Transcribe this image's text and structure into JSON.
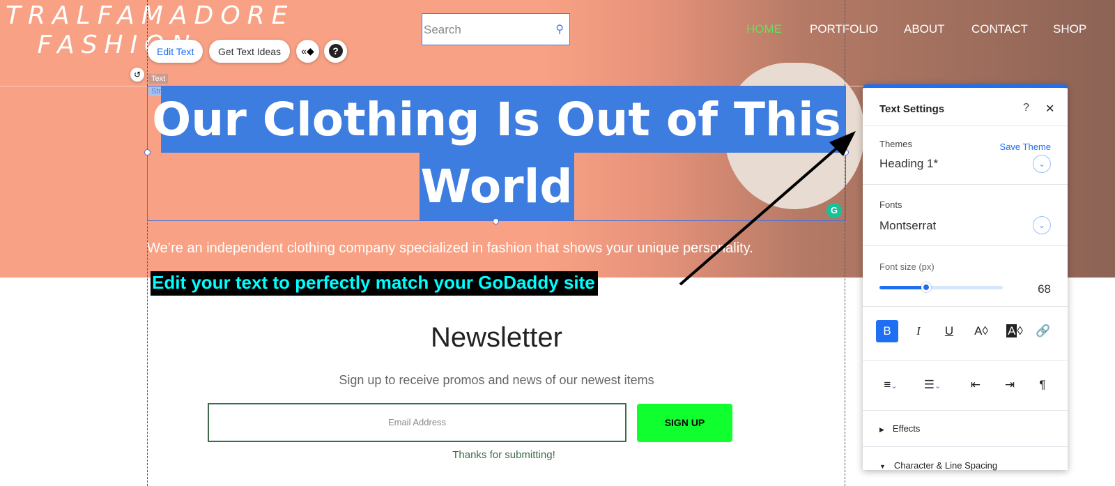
{
  "site": {
    "logo_line1": "TRALFAMADORE",
    "logo_line2": "FASHION",
    "search_placeholder": "Search",
    "nav": [
      {
        "label": "HOME",
        "color": "#66e05a"
      },
      {
        "label": "PORTFOLIO"
      },
      {
        "label": "ABOUT"
      },
      {
        "label": "CONTACT"
      },
      {
        "label": "SHOP"
      }
    ],
    "heading_line1": "Our Clothing Is Out of This",
    "heading_line2": "World",
    "subtitle": "We’re an independent clothing company specialized in fashion that shows your unique personality.",
    "newsletter": {
      "title": "Newsletter",
      "subtitle": "Sign up to receive promos and news of our newest items",
      "email_placeholder": "Email Address",
      "button": "SIGN UP",
      "thanks": "Thanks for submitting!"
    }
  },
  "editor": {
    "edit_text": "Edit Text",
    "get_text_ideas": "Get Text Ideas",
    "tag_text": "Text",
    "tag_strip": "Strip"
  },
  "callout": "Edit your text to perfectly match your GoDaddy site",
  "panel": {
    "title": "Text Settings",
    "help": "?",
    "close": "✕",
    "themes_label": "Themes",
    "save_theme": "Save Theme",
    "theme_value": "Heading 1*",
    "fonts_label": "Fonts",
    "font_value": "Montserrat",
    "size_label": "Font size (px)",
    "size_value": "68",
    "size_fraction": 0.38,
    "effects": "Effects",
    "spacing": "Character & Line Spacing"
  },
  "colors": {
    "accent": "#1e6ff2",
    "selection": "#3d7de0",
    "hero": "#f8a184",
    "signup": "#0fff2f",
    "callout_text": "#00ffff"
  }
}
